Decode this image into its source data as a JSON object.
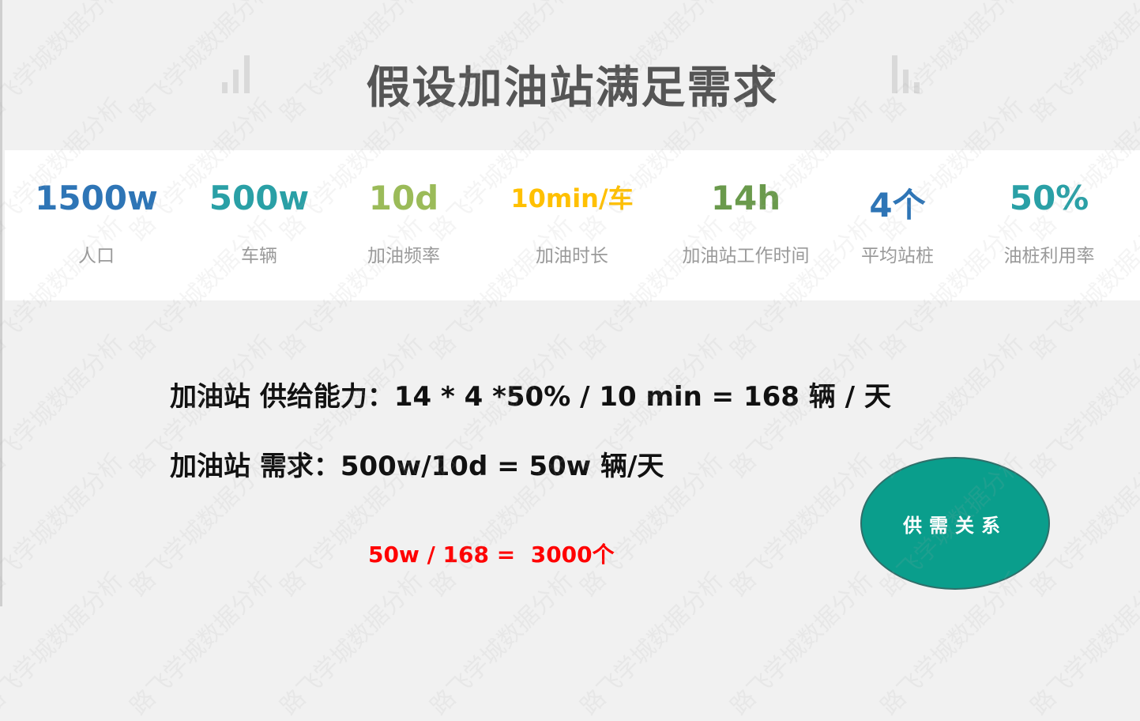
{
  "title": "假设加油站满足需求",
  "metrics": [
    {
      "value": "1500w",
      "label": "人口",
      "color": "#2e75b6"
    },
    {
      "value": "500w",
      "label": "车辆",
      "color": "#2aa0a6"
    },
    {
      "value": "10d",
      "label": "加油频率",
      "color": "#9bbb59"
    },
    {
      "value": "10min/车",
      "label": "加油时长",
      "color": "#ffc000"
    },
    {
      "value": "14h",
      "label": "加油站工作时间",
      "color": "#6a9a4c"
    },
    {
      "value": "4个",
      "label": "平均站桩",
      "color": "#2e75b6"
    },
    {
      "value": "50%",
      "label": "油桩利用率",
      "color": "#2aa0a6"
    }
  ],
  "formulas": {
    "supply": "加油站 供给能力：14 * 4 *50% / 10 min = 168 辆 / 天",
    "demand": "加油站 需求：500w/10d = 50w 辆/天",
    "result": "50w / 168 =  3000个"
  },
  "badge": {
    "label": "供需关系",
    "color": "#0a9e8c"
  },
  "watermark": "路飞学城数据分析"
}
